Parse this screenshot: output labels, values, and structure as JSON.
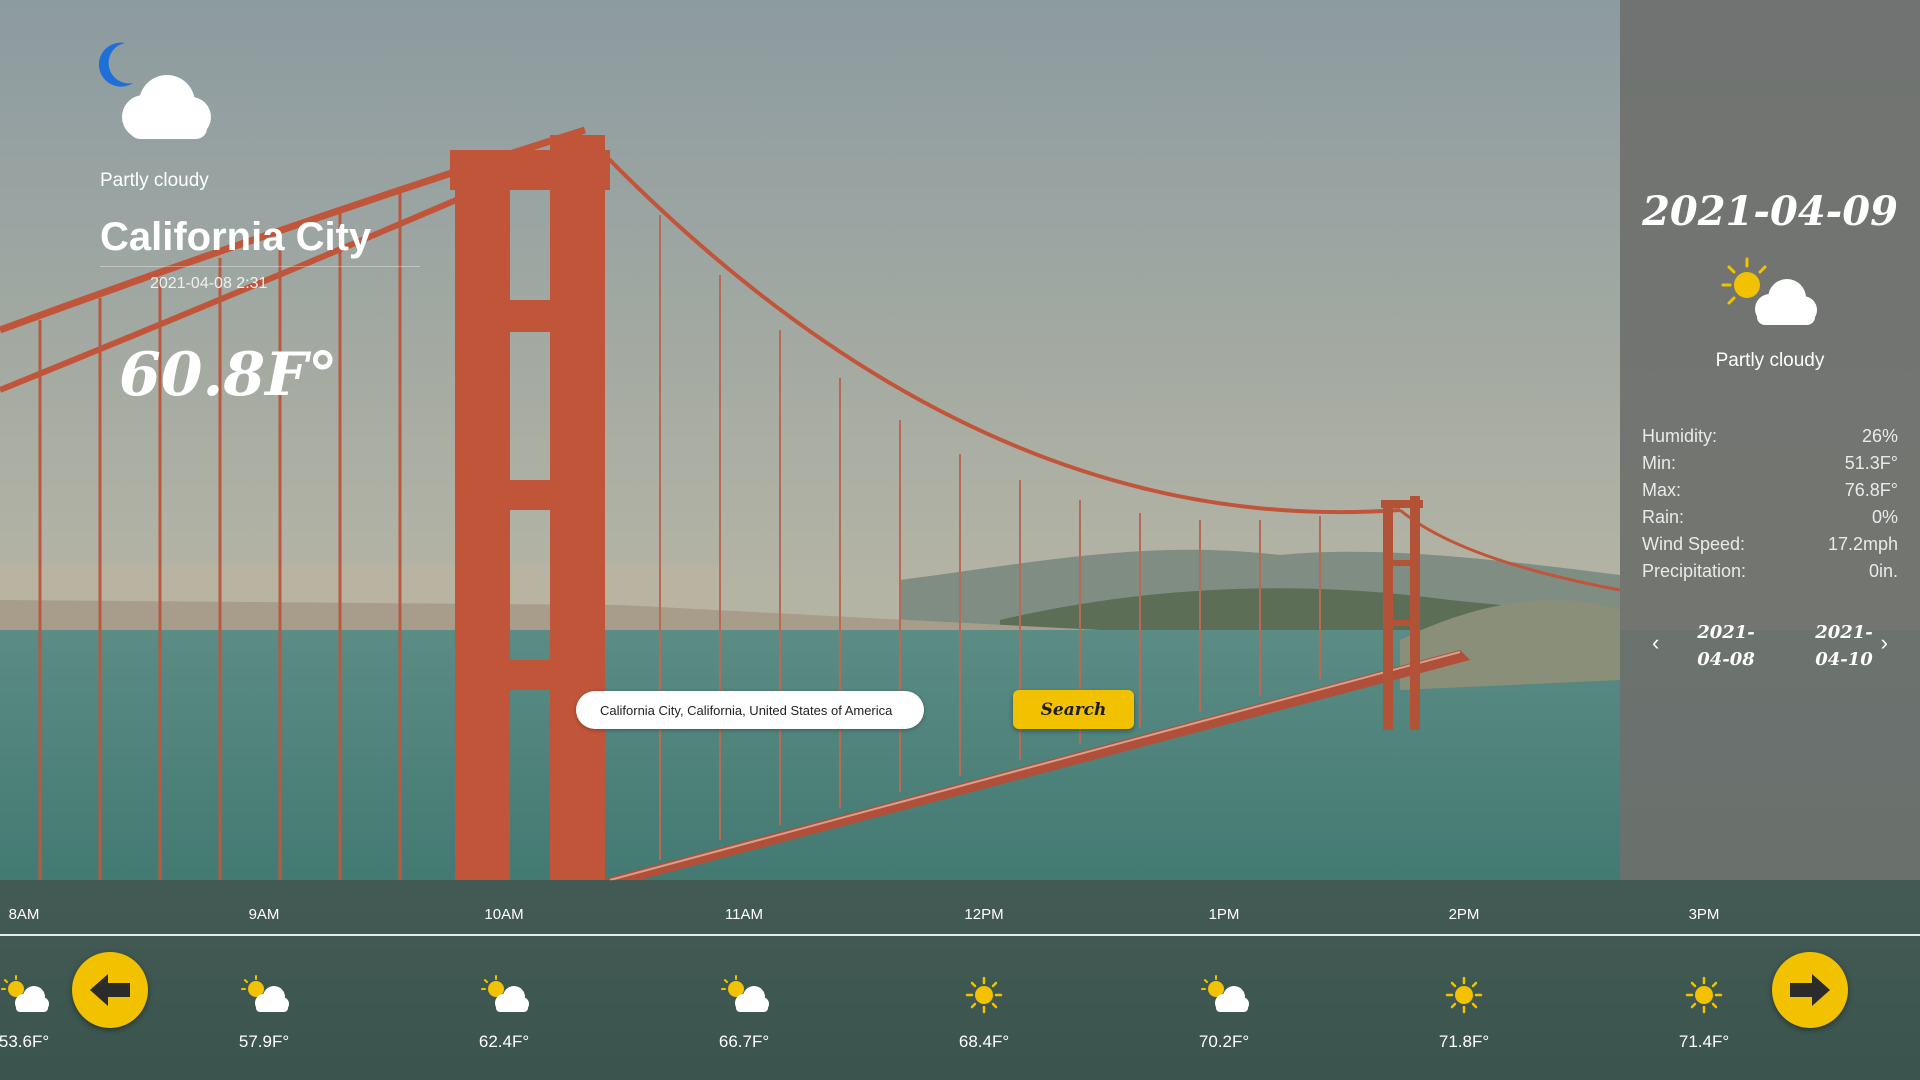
{
  "current": {
    "condition": "Partly cloudy",
    "city": "California City",
    "datetime": "2021-04-08 2:31",
    "temperature": "60.8F°",
    "icon": "moon-cloud-icon"
  },
  "search": {
    "value": "California City, California, United States of America",
    "button_label": "Search"
  },
  "forecast": {
    "date": "2021-04-09",
    "condition": "Partly cloudy",
    "icon": "sun-cloud-icon",
    "stats": [
      {
        "label": "Humidity:",
        "value": "26%"
      },
      {
        "label": "Min:",
        "value": "51.3F°"
      },
      {
        "label": "Max:",
        "value": "76.8F°"
      },
      {
        "label": "Rain:",
        "value": "0%"
      },
      {
        "label": "Wind Speed:",
        "value": "17.2mph"
      },
      {
        "label": "Precipitation:",
        "value": "0in."
      }
    ],
    "prev_date": "2021-04-08",
    "next_date": "2021-04-10",
    "prev_date_line1": "2021-",
    "prev_date_line2": "04-08",
    "next_date_line1": "2021-",
    "next_date_line2": "04-10"
  },
  "hourly": [
    {
      "time": "8AM",
      "temp": "53.6F°",
      "icon": "sun-cloud-icon"
    },
    {
      "time": "9AM",
      "temp": "57.9F°",
      "icon": "sun-cloud-icon"
    },
    {
      "time": "10AM",
      "temp": "62.4F°",
      "icon": "sun-cloud-icon"
    },
    {
      "time": "11AM",
      "temp": "66.7F°",
      "icon": "sun-cloud-icon"
    },
    {
      "time": "12PM",
      "temp": "68.4F°",
      "icon": "sun-icon"
    },
    {
      "time": "1PM",
      "temp": "70.2F°",
      "icon": "sun-cloud-icon"
    },
    {
      "time": "2PM",
      "temp": "71.8F°",
      "icon": "sun-icon"
    },
    {
      "time": "3PM",
      "temp": "71.4F°",
      "icon": "sun-icon"
    }
  ],
  "colors": {
    "accent": "#f2c200",
    "panel": "#6e706c",
    "bridge": "#c1553a",
    "water": "#3f7770"
  }
}
